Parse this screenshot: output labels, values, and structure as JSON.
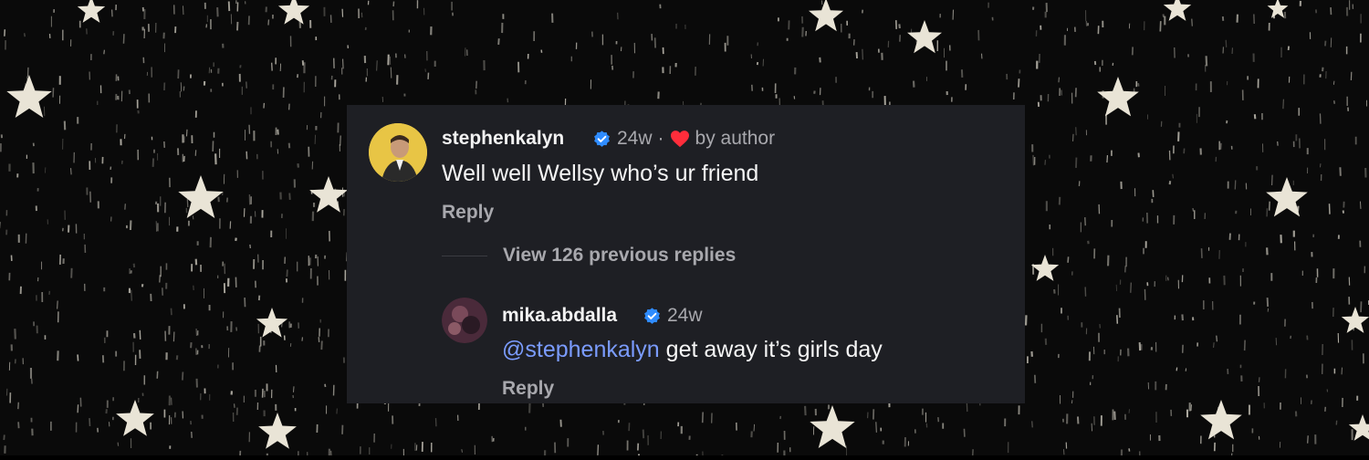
{
  "comments": [
    {
      "username": "stephenkalyn",
      "time": "24w",
      "separator": "·",
      "liked_by_author": "by author",
      "text": "Well well Wellsy who’s ur friend",
      "reply_label": "Reply"
    }
  ],
  "thread": {
    "view_replies": "View 126 previous replies"
  },
  "replies": [
    {
      "username": "mika.abdalla",
      "time": "24w",
      "mention": "@stephenkalyn",
      "text": " get away it’s girls day",
      "reply_label": "Reply"
    }
  ],
  "colors": {
    "card_bg": "#1e1f24",
    "verified": "#2f8cff",
    "heart": "#ff2d3b",
    "mention": "#7b9cff"
  }
}
